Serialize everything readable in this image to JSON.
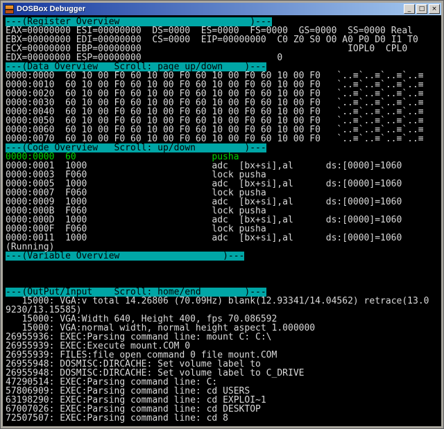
{
  "window": {
    "title": "DOSBox Debugger",
    "buttons": {
      "minimize": "_",
      "maximize": "□",
      "close": "×"
    }
  },
  "colors": {
    "header_bg": "#00A6A6",
    "header_text": "#000000",
    "current_line": "#00D400",
    "console_text": "#DADADA",
    "console_bg": "#000000",
    "titlebar_left": "#15389E",
    "titlebar_right": "#A6CAF0",
    "frame": "#ABA8A0"
  },
  "sections": {
    "registers": {
      "header": "---(Register Overview                        )---",
      "lines": [
        "EAX=00000000 ESI=00000000  DS=0000  ES=0000  FS=0000  GS=0000  SS=0000 Real",
        "EBX=00000000 EDI=00000000  CS=0000  EIP=00000000  C0 Z0 S0 O0 A0 P0 D0 I1 T0",
        "ECX=00000000 EBP=00000000                                      IOPL0  CPL0",
        "EDX=00000000 ESP=00000000                         0"
      ]
    },
    "data": {
      "header": "---(Data Overview   Scroll: page up/down    )---",
      "rows": [
        {
          "addr": "0000:0000",
          "hex": "60 10 00 F0 60 10 00 F0 60 10 00 F0 60 10 00 F0",
          "ascii": "`..≡`..≡`..≡`..≡"
        },
        {
          "addr": "0000:0010",
          "hex": "60 10 00 F0 60 10 00 F0 60 10 00 F0 60 10 00 F0",
          "ascii": "`..≡`..≡`..≡`..≡"
        },
        {
          "addr": "0000:0020",
          "hex": "60 10 00 F0 60 10 00 F0 60 10 00 F0 60 10 00 F0",
          "ascii": "`..≡`..≡`..≡`..≡"
        },
        {
          "addr": "0000:0030",
          "hex": "60 10 00 F0 60 10 00 F0 60 10 00 F0 60 10 00 F0",
          "ascii": "`..≡`..≡`..≡`..≡"
        },
        {
          "addr": "0000:0040",
          "hex": "60 10 00 F0 60 10 00 F0 60 10 00 F0 60 10 00 F0",
          "ascii": "`..≡`..≡`..≡`..≡"
        },
        {
          "addr": "0000:0050",
          "hex": "60 10 00 F0 60 10 00 F0 60 10 00 F0 60 10 00 F0",
          "ascii": "`..≡`..≡`..≡`..≡"
        },
        {
          "addr": "0000:0060",
          "hex": "60 10 00 F0 60 10 00 F0 60 10 00 F0 60 10 00 F0",
          "ascii": "`..≡`..≡`..≡`..≡"
        },
        {
          "addr": "0000:0070",
          "hex": "60 10 00 F0 60 10 00 F0 60 10 00 F0 60 10 00 F0",
          "ascii": "`..≡`..≡`..≡`..≡"
        }
      ]
    },
    "code": {
      "header": "---(Code Overview   Scroll: up/down         )---",
      "rows": [
        {
          "addr": "0000:0000",
          "bytes": "60",
          "instr": "pusha",
          "info": "",
          "current": true
        },
        {
          "addr": "0000:0001",
          "bytes": "1000",
          "instr": "adc  [bx+si],al",
          "info": "ds:[0000]=1060"
        },
        {
          "addr": "0000:0003",
          "bytes": "F060",
          "instr": "lock pusha",
          "info": ""
        },
        {
          "addr": "0000:0005",
          "bytes": "1000",
          "instr": "adc  [bx+si],al",
          "info": "ds:[0000]=1060"
        },
        {
          "addr": "0000:0007",
          "bytes": "F060",
          "instr": "lock pusha",
          "info": ""
        },
        {
          "addr": "0000:0009",
          "bytes": "1000",
          "instr": "adc  [bx+si],al",
          "info": "ds:[0000]=1060"
        },
        {
          "addr": "0000:000B",
          "bytes": "F060",
          "instr": "lock pusha",
          "info": ""
        },
        {
          "addr": "0000:000D",
          "bytes": "1000",
          "instr": "adc  [bx+si],al",
          "info": "ds:[0000]=1060"
        },
        {
          "addr": "0000:000F",
          "bytes": "F060",
          "instr": "lock pusha",
          "info": ""
        },
        {
          "addr": "0000:0011",
          "bytes": "1000",
          "instr": "adc  [bx+si],al",
          "info": "ds:[0000]=1060"
        }
      ],
      "status": "(Running)"
    },
    "variables": {
      "header": "---(Variable Overview                   )---"
    },
    "output": {
      "header": "---(OutPut/Input    Scroll: home/end        )---",
      "lines": [
        "   15000: VGA:v total 14.26806 (70.09Hz) blank(12.93341/14.04562) retrace(13.0",
        "9230/13.15585)",
        "   15000: VGA:Width 640, Height 400, fps 70.086592",
        "   15000: VGA:normal width, normal height aspect 1.000000",
        "26955936: EXEC:Parsing command line: mount C: C:\\",
        "26955939: EXEC:Execute mount.COM 0",
        "26955939: FILES:file open command 0 file mount.COM",
        "26955948: DOSMISC:DIRCACHE: Set volume label to ",
        "26955948: DOSMISC:DIRCACHE: Set volume label to C_DRIVE",
        "47290514: EXEC:Parsing command line: C:",
        "57806909: EXEC:Parsing command line: cd USERS",
        "63198290: EXEC:Parsing command line: cd EXPLOI~1",
        "67007026: EXEC:Parsing command line: cd DESKTOP",
        "72507507: EXEC:Parsing command line: cd 8"
      ]
    }
  }
}
